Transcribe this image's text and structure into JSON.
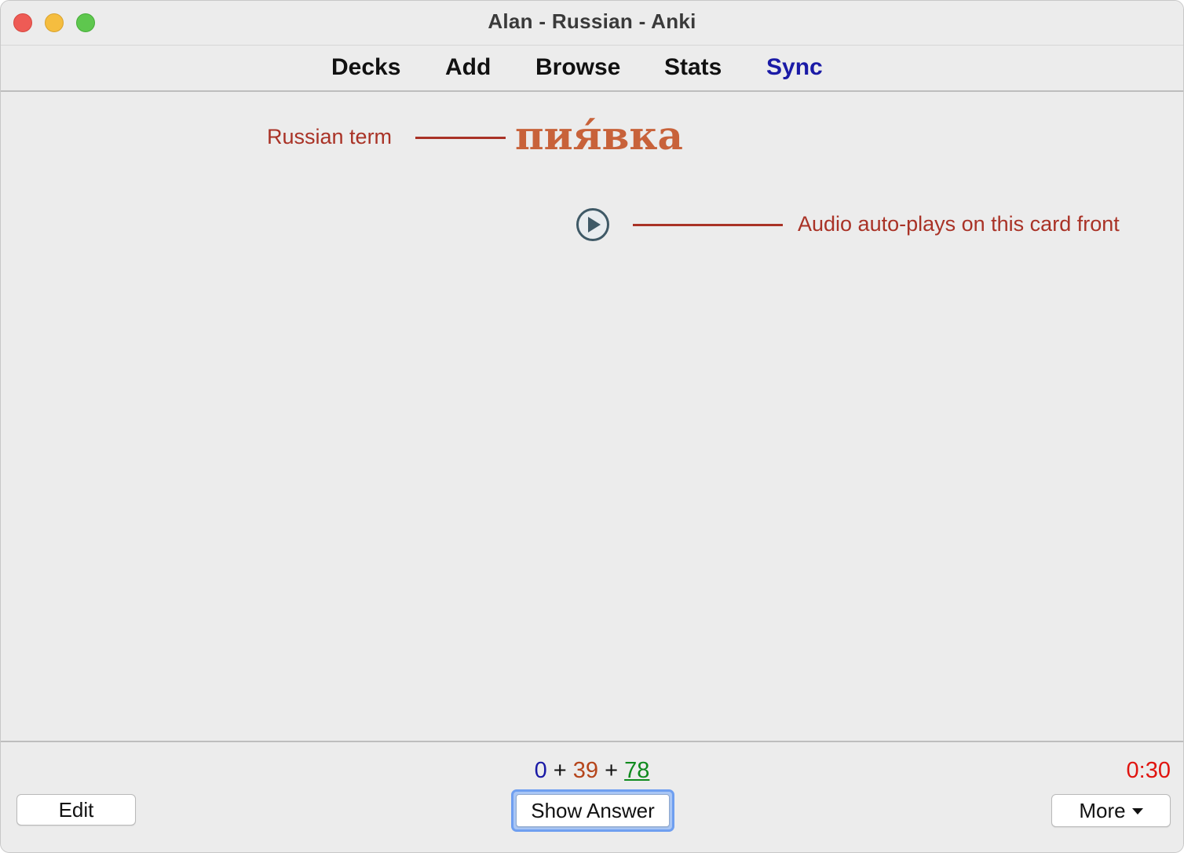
{
  "window": {
    "title": "Alan - Russian - Anki"
  },
  "toolbar": {
    "decks": "Decks",
    "add": "Add",
    "browse": "Browse",
    "stats": "Stats",
    "sync": "Sync",
    "sync_color": "#1a1aa6"
  },
  "card": {
    "term": "пия́вка",
    "term_color": "#c8623a",
    "audio_icon": "play-icon"
  },
  "annotations": {
    "term_label": "Russian term",
    "audio_label": "Audio auto-plays on this card front",
    "color": "#a93226"
  },
  "bottom": {
    "counts": {
      "new": "0",
      "learn": "39",
      "review": "78",
      "separator": "+",
      "new_color": "#1a1aa6",
      "learn_color": "#b5451b",
      "review_color": "#0f8a1e"
    },
    "timer": "0:30",
    "timer_color": "#e0140f",
    "edit_label": "Edit",
    "show_answer_label": "Show Answer",
    "more_label": "More"
  }
}
